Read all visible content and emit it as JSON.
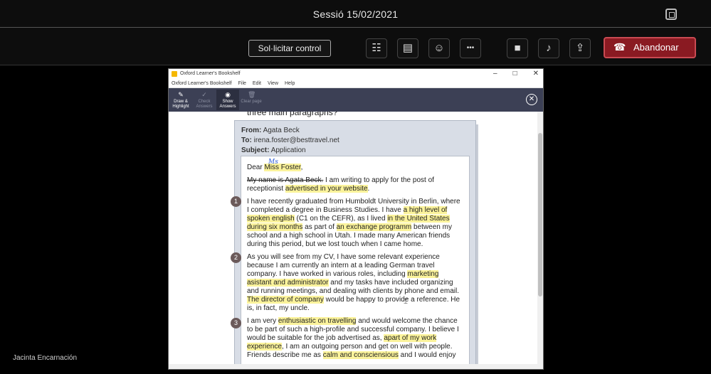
{
  "meeting": {
    "session_title": "Sessió 15/02/2021",
    "control_label": "Sol·licitar control",
    "leave_label": "Abandonar",
    "tools": [
      {
        "name": "participants-icon",
        "glyph": "☷"
      },
      {
        "name": "chat-icon",
        "glyph": "▤"
      },
      {
        "name": "reactions-icon",
        "glyph": "☺"
      },
      {
        "name": "more-icon",
        "glyph": "•••"
      },
      {
        "name": "camera-icon",
        "glyph": "■"
      },
      {
        "name": "microphone-icon",
        "glyph": "♪"
      },
      {
        "name": "share-screen-icon",
        "glyph": "⇪"
      }
    ],
    "presenter_label": "Jacinta Encarnación"
  },
  "app": {
    "window_title": "Oxford Learner's Bookshelf",
    "menu": [
      "Oxford Learner's Bookshelf",
      "File",
      "Edit",
      "View",
      "Help"
    ],
    "toolbar": [
      {
        "label": "Draw & Highlight",
        "glyph": "✎",
        "state": "normal"
      },
      {
        "label": "Check Answers",
        "glyph": "✓",
        "state": "disabled"
      },
      {
        "label": "Show Answers",
        "glyph": "◉",
        "state": "active"
      },
      {
        "label": "Clear page",
        "glyph": "🗑",
        "state": "disabled"
      }
    ],
    "question_text": "three main paragraphs?",
    "email": {
      "from_label": "From:",
      "from_value": "Agata Beck",
      "to_label": "To:",
      "to_value": "irena.foster@besttravel.net",
      "subject_label": "Subject:",
      "subject_value": "Application",
      "handwritten_note": "Ms",
      "greeting_prefix": "Dear ",
      "greeting_name": "Miss Foster",
      "greeting_suffix": ",",
      "intro_strike": "My name is Agata Beck.",
      "intro_rest": " I am writing to apply for the post of receptionist ",
      "intro_hl": "advertised in your website",
      "intro_end": ".",
      "p1_a": "I have recently graduated from Humboldt University in Berlin, where I completed a degree in Business Studies. I have ",
      "p1_hl1": "a high level of spoken english",
      "p1_b": " (C1 on the CEFR), as I lived ",
      "p1_hl2": "in the United States during six months",
      "p1_c": " as part of ",
      "p1_hl3": "an exchange programm",
      "p1_d": " between my school and a high school in Utah. I made many American friends during this period, but we lost touch when I came home.",
      "p2_a": "As you will see from my CV, I have some relevant experience because I am currently an intern at a leading German travel company. I have worked in various roles, including ",
      "p2_hl1": "marketing asistant and administrator",
      "p2_b": " and my tasks have included organizing and running meetings, and dealing with clients by phone and email. ",
      "p2_hl2": "The director of company",
      "p2_c": " would be happy to provide a reference. He is, in fact, my uncle.",
      "p3_a": "I am very ",
      "p3_hl1": "enthusiastic on travelling",
      "p3_b": " and would welcome the chance to be part of such a high-profile and successful company. I believe I would be suitable for the job advertised as, ",
      "p3_hl2": "apart of my work experience",
      "p3_c": ", I am an outgoing person and get on well with people. Friends describe me as ",
      "p3_hl3": "calm and consciensious",
      "p3_d": " and I would enjoy",
      "numbers": [
        "1",
        "2",
        "3"
      ]
    }
  }
}
